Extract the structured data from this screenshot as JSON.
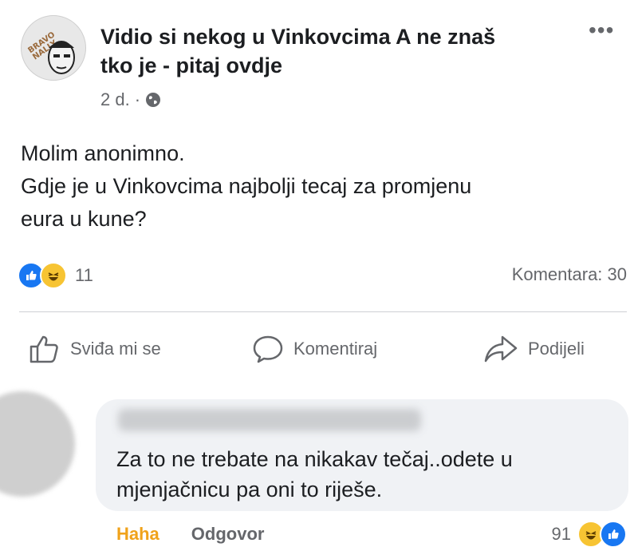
{
  "post": {
    "group_name_line1": "Vidio si nekog u Vinkovcima A ne znaš",
    "group_name_line2": "tko je - pitaj ovdje",
    "avatar_tag": "BRAVO NALLY",
    "time": "2 d. ·",
    "text_line1": "Molim anonimno.",
    "text_line2": "Gdje je u Vinkovcima najbolji tecaj za promjenu",
    "text_line3": "eura u kune?",
    "reaction_count": "11",
    "comment_count": "Komentara: 30"
  },
  "actions": {
    "like": "Sviđa mi se",
    "comment": "Komentiraj",
    "share": "Podijeli"
  },
  "comment": {
    "text_line1": "Za to ne trebate na nikakav tečaj..odete u",
    "text_line2": "mjenjačnicu pa oni to riješe.",
    "haha_label": "Haha",
    "reply_label": "Odgovor",
    "reaction_count": "91"
  },
  "colors": {
    "like_blue": "#1877f2",
    "haha_yellow": "#f7c433",
    "haha_text": "#f0a21a",
    "muted": "#65676b"
  }
}
